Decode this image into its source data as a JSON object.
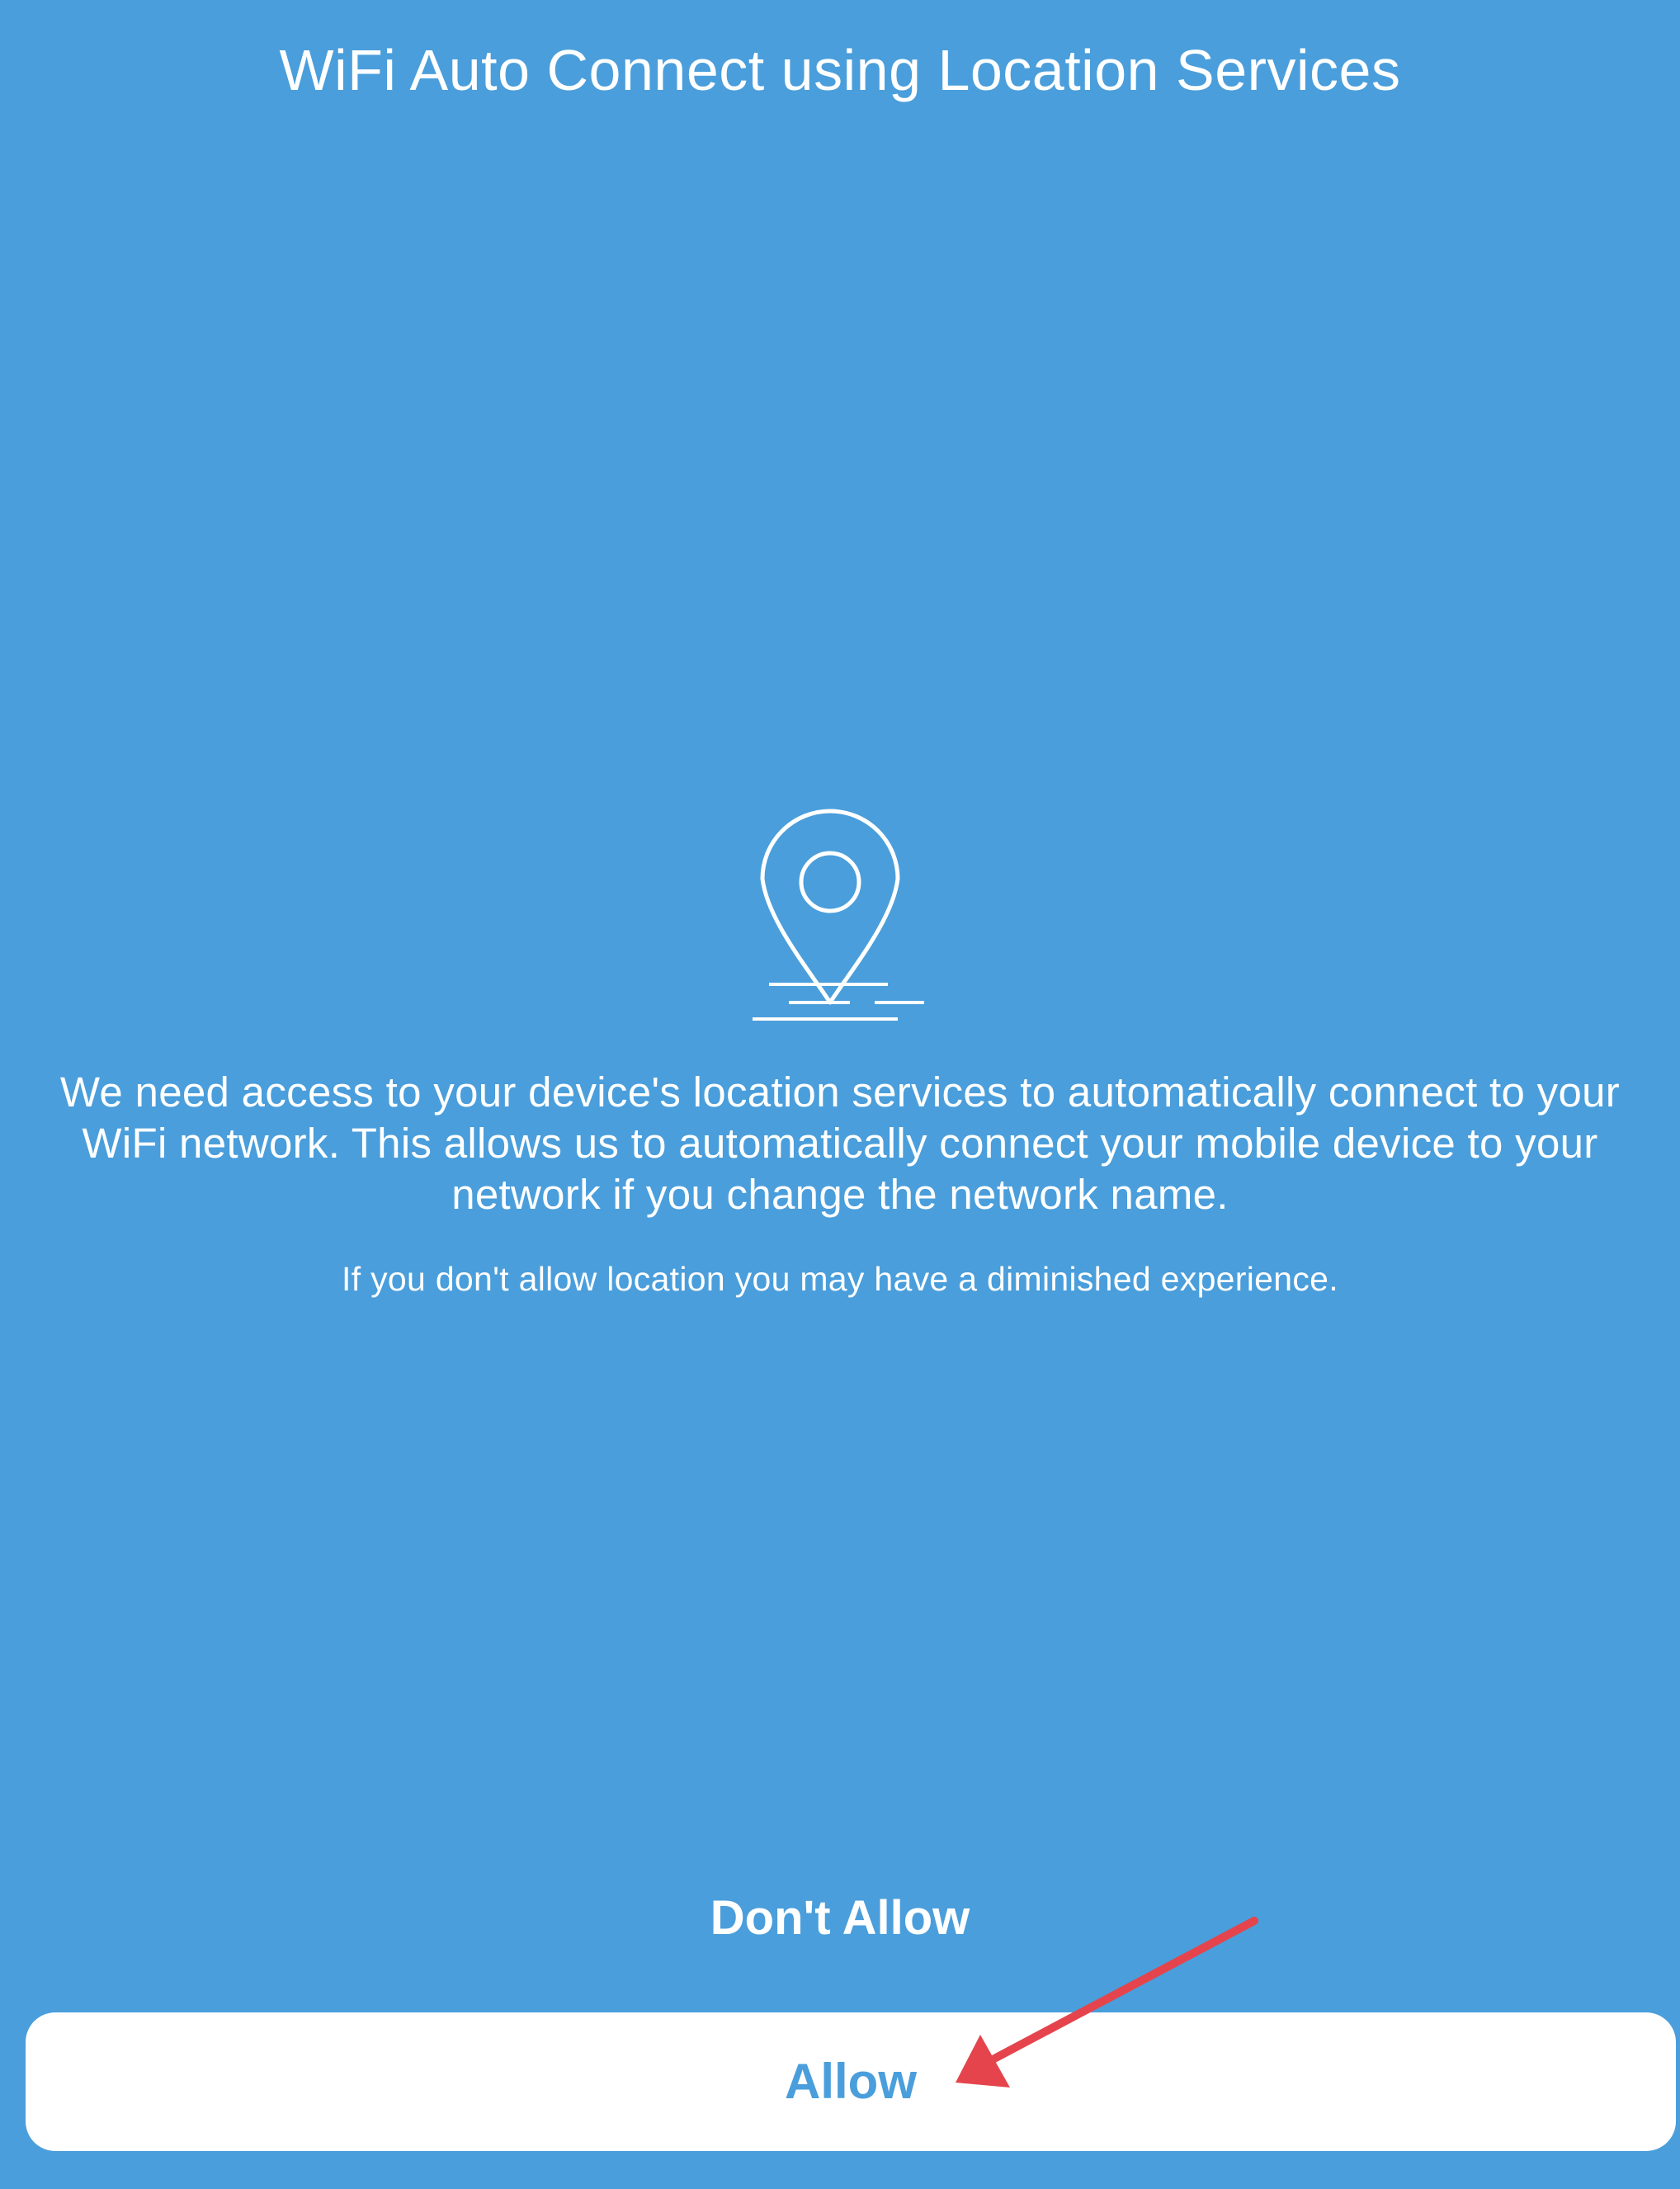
{
  "screen": {
    "title": "WiFi Auto Connect using Location Services",
    "description": "We need access to your device's location services to automatically connect to your WiFi network. This allows us to automatically connect your mobile device to your network if you change the network name.",
    "note": "If you don't allow location you may have a diminished experience."
  },
  "icons": {
    "hero": "location-pin-icon",
    "annotation": "red-arrow"
  },
  "actions": {
    "dont_allow_label": "Don't Allow",
    "allow_label": "Allow"
  },
  "colors": {
    "background": "#4a9edb",
    "text": "#ffffff",
    "allow_button_bg": "#ffffff",
    "allow_button_text": "#4a9edb",
    "annotation_arrow": "#e5444c"
  }
}
